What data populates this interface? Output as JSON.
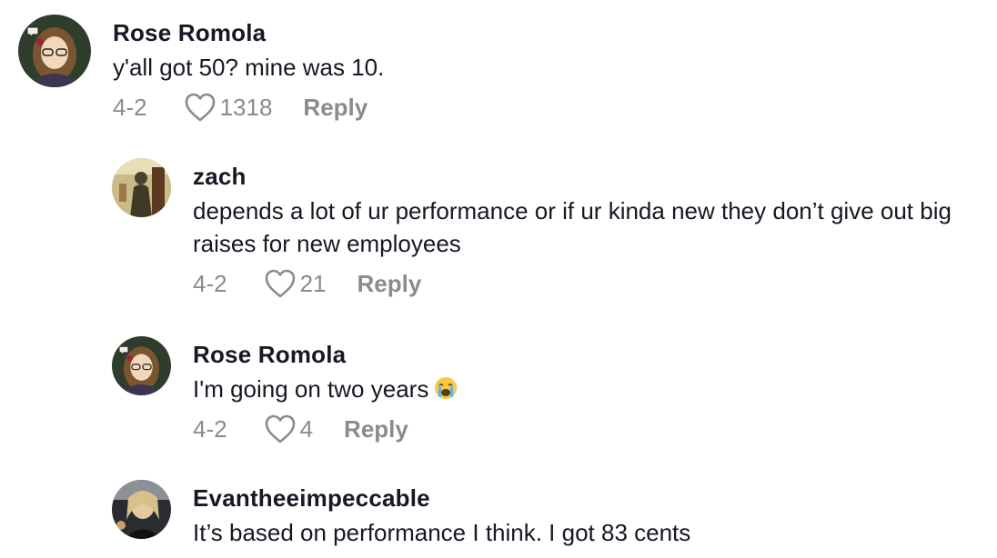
{
  "comments": [
    {
      "username": "Rose Romola",
      "text": "y'all got 50? mine was 10.",
      "date": "4-2",
      "likes": "1318",
      "reply_label": "Reply"
    },
    {
      "username": "zach",
      "text": "depends a lot of ur performance or if ur kinda new they don’t give out big raises for new employees",
      "date": "4-2",
      "likes": "21",
      "reply_label": "Reply"
    },
    {
      "username": "Rose Romola",
      "text": "I'm going on two years",
      "emoji": "loudly-crying-face-icon",
      "date": "4-2",
      "likes": "4",
      "reply_label": "Reply"
    },
    {
      "username": "Evantheeimpeccable",
      "text": "It’s based on performance I think. I got 83 cents"
    }
  ],
  "colors": {
    "text": "#161823",
    "muted": "#8a8b91",
    "background": "#ffffff"
  }
}
